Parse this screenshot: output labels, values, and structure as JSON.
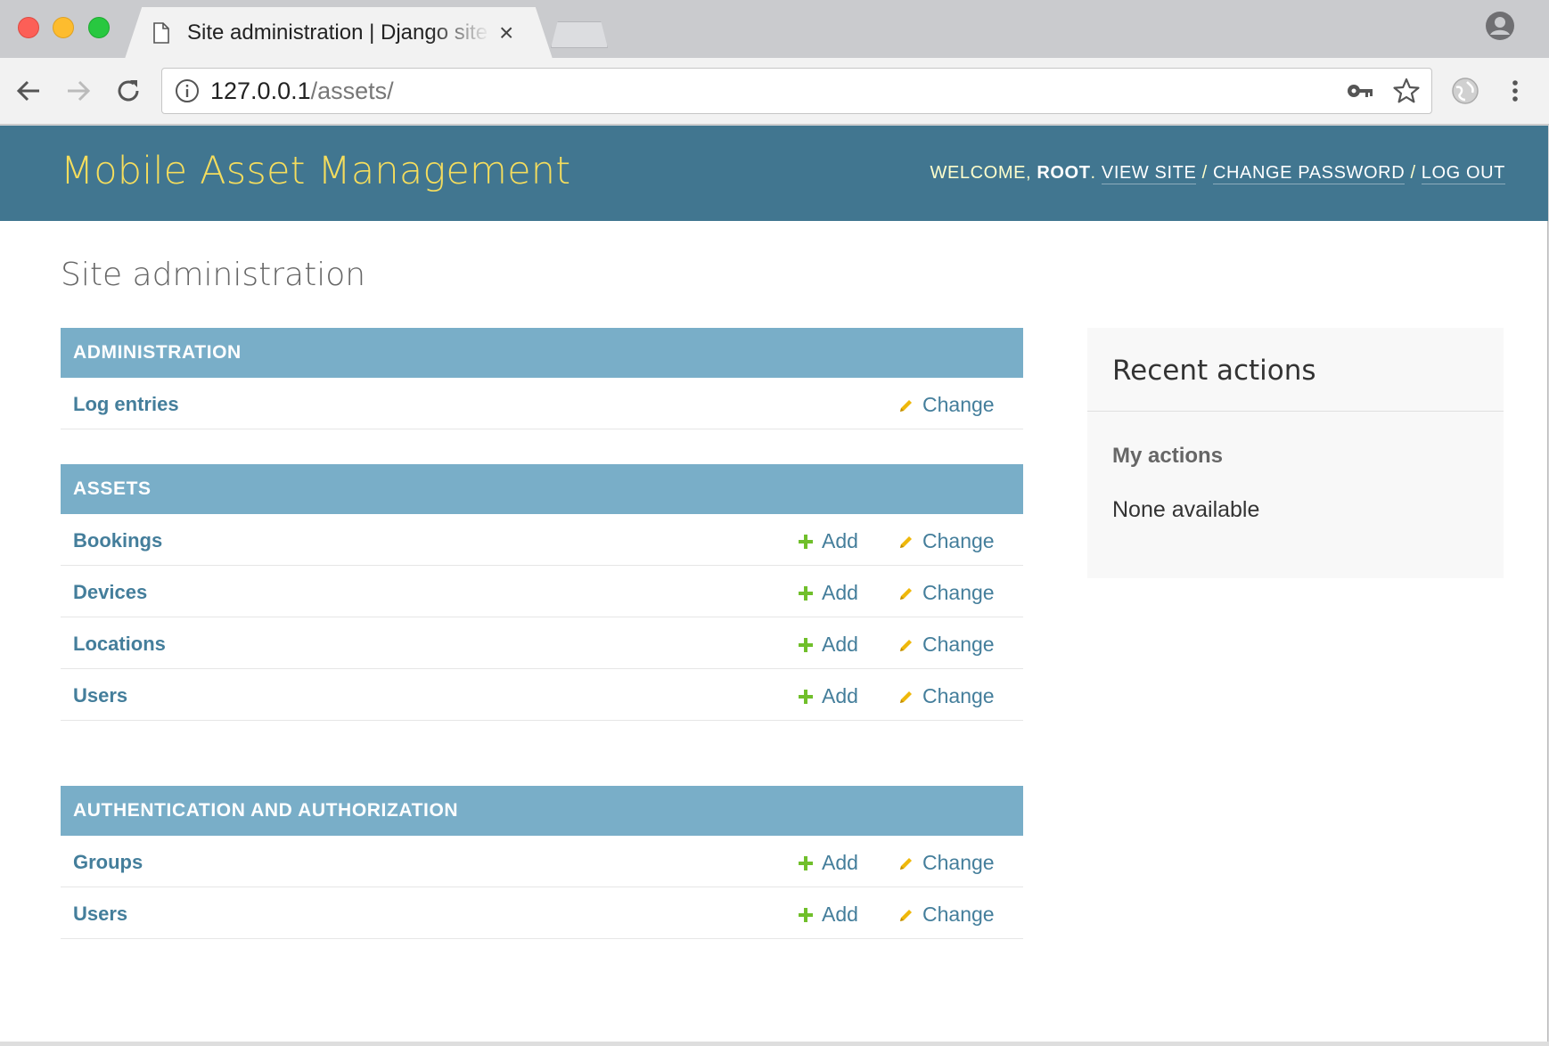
{
  "browser": {
    "tab_title": "Site administration | Django site admin",
    "tab_close": "×",
    "url_host": "127.0.0.1",
    "url_path": "/assets/"
  },
  "header": {
    "branding": "Mobile Asset Management",
    "welcome_prefix": "Welcome,",
    "username": "root",
    "separator_dot": ".",
    "view_site": "View site",
    "change_password": "Change password",
    "log_out": "Log out",
    "slash": "/"
  },
  "page": {
    "title": "Site administration"
  },
  "modules": [
    {
      "caption": "Administration",
      "rows": [
        {
          "name": "Log entries",
          "add": "",
          "change": "Change"
        }
      ]
    },
    {
      "caption": "Assets",
      "rows": [
        {
          "name": "Bookings",
          "add": "Add",
          "change": "Change"
        },
        {
          "name": "Devices",
          "add": "Add",
          "change": "Change"
        },
        {
          "name": "Locations",
          "add": "Add",
          "change": "Change"
        },
        {
          "name": "Users",
          "add": "Add",
          "change": "Change"
        }
      ]
    },
    {
      "caption": "Authentication and Authorization",
      "rows": [
        {
          "name": "Groups",
          "add": "Add",
          "change": "Change"
        },
        {
          "name": "Users",
          "add": "Add",
          "change": "Change"
        }
      ]
    }
  ],
  "recent_actions": {
    "title": "Recent actions",
    "subtitle": "My actions",
    "empty": "None available"
  },
  "colors": {
    "header_bg": "#417690",
    "branding": "#f5dd5d",
    "caption_bg": "#79aec8",
    "link": "#447e9b",
    "add_icon": "#70bf2b",
    "change_icon": "#efb80b"
  }
}
